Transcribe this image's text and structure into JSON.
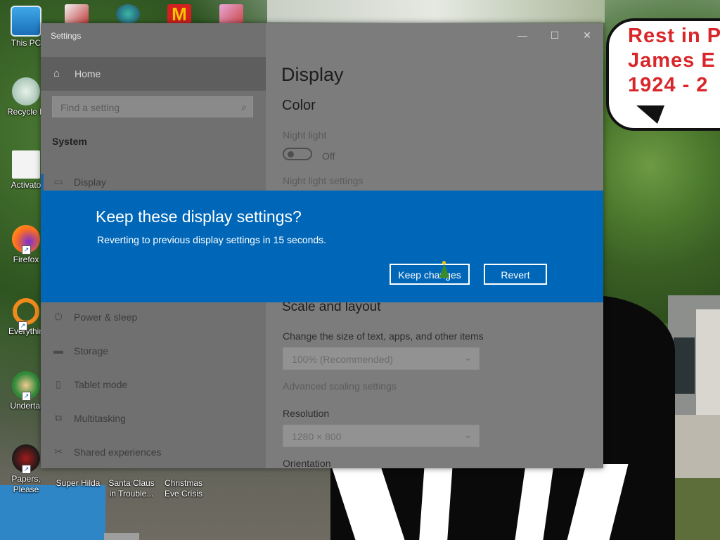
{
  "desktop": {
    "bubble_lines": [
      "Rest in P",
      "James E",
      "1924 - 2"
    ],
    "icons": [
      {
        "label": "This PC"
      },
      {
        "label": "Recycle B"
      },
      {
        "label": "Activato"
      },
      {
        "label": "Firefox"
      },
      {
        "label": "Everythin"
      },
      {
        "label": "Undertal"
      },
      {
        "label": "Papers, Please"
      },
      {
        "label": "Super Hilda"
      },
      {
        "label": "Santa Claus in Trouble..."
      },
      {
        "label": "Christmas Eve Crisis"
      }
    ]
  },
  "window": {
    "title": "Settings",
    "controls": {
      "minimize": "—",
      "maximize": "☐",
      "close": "✕"
    },
    "nav": {
      "home": "Home",
      "search_placeholder": "Find a setting",
      "section": "System",
      "items": [
        {
          "label": "Display",
          "icon": "monitor-icon"
        },
        {
          "label": "Power & sleep",
          "icon": "power-icon"
        },
        {
          "label": "Storage",
          "icon": "storage-icon"
        },
        {
          "label": "Tablet mode",
          "icon": "tablet-icon"
        },
        {
          "label": "Multitasking",
          "icon": "multitasking-icon"
        },
        {
          "label": "Shared experiences",
          "icon": "shared-icon"
        }
      ]
    },
    "content": {
      "heading": "Display",
      "color_heading": "Color",
      "night_light_label": "Night light",
      "night_light_state": "Off",
      "night_light_settings": "Night light settings",
      "scale_heading": "Scale and layout",
      "size_label": "Change the size of text, apps, and other items",
      "size_value": "100% (Recommended)",
      "advanced_scaling": "Advanced scaling settings",
      "resolution_label": "Resolution",
      "resolution_value": "1280 × 800",
      "orientation_label": "Orientation"
    }
  },
  "dialog": {
    "title": "Keep these display settings?",
    "message": "Reverting to previous display settings in 15 seconds.",
    "keep_label": "Keep changes",
    "revert_label": "Revert"
  },
  "colors": {
    "dialog_bg": "#0067b8",
    "bubble_text": "#d8262a"
  }
}
